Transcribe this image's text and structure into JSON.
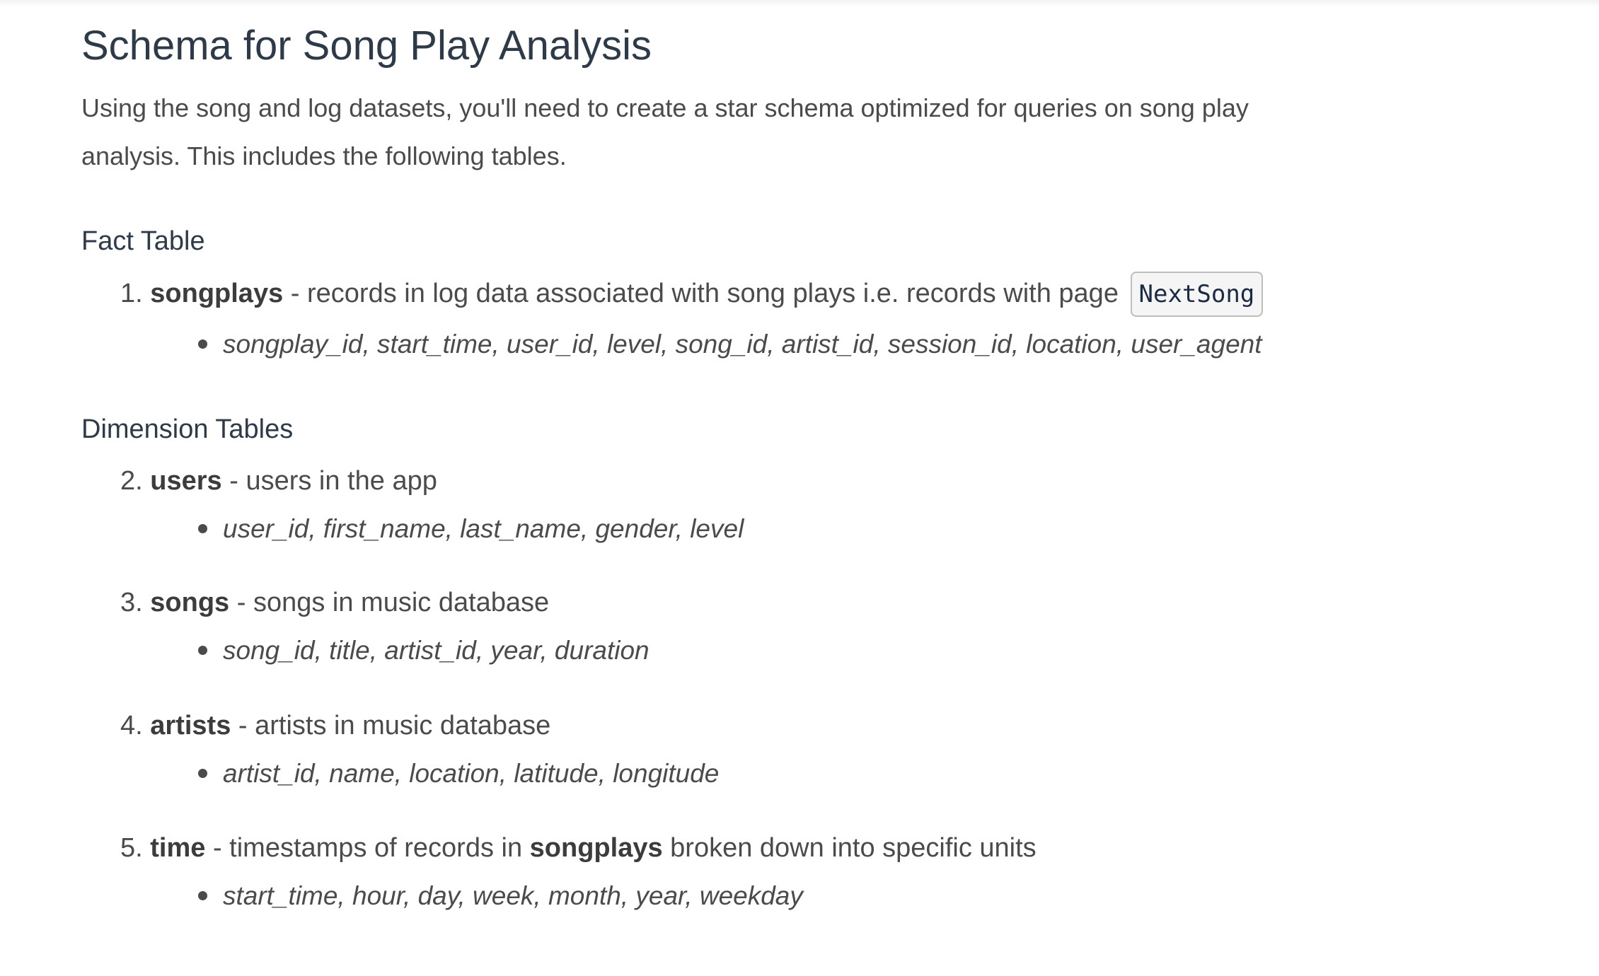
{
  "title": "Schema for Song Play Analysis",
  "intro": {
    "line1": "Using the song and log datasets, you'll need to create a star schema optimized for queries on song play",
    "line2": "analysis. This includes the following tables."
  },
  "fact_heading": "Fact Table",
  "dimension_heading": "Dimension Tables",
  "tables": [
    {
      "number": "1.",
      "name": "songplays",
      "desc": " - records in log data associated with song plays i.e. records with page ",
      "code": "NextSong",
      "columns": "songplay_id, start_time, user_id, level, song_id, artist_id, session_id, location, user_agent"
    },
    {
      "number": "2.",
      "name": "users",
      "desc": " - users in the app",
      "columns": "user_id, first_name, last_name, gender, level"
    },
    {
      "number": "3.",
      "name": "songs",
      "desc": " - songs in music database",
      "columns": "song_id, title, artist_id, year, duration"
    },
    {
      "number": "4.",
      "name": "artists",
      "desc": " - artists in music database",
      "columns": "artist_id, name, location, latitude, longitude"
    },
    {
      "number": "5.",
      "name": "time",
      "desc": " - timestamps of records in ",
      "desc_bold": "songplays",
      "desc_tail": " broken down into specific units",
      "columns": "start_time, hour, day, week, month, year, weekday"
    }
  ]
}
